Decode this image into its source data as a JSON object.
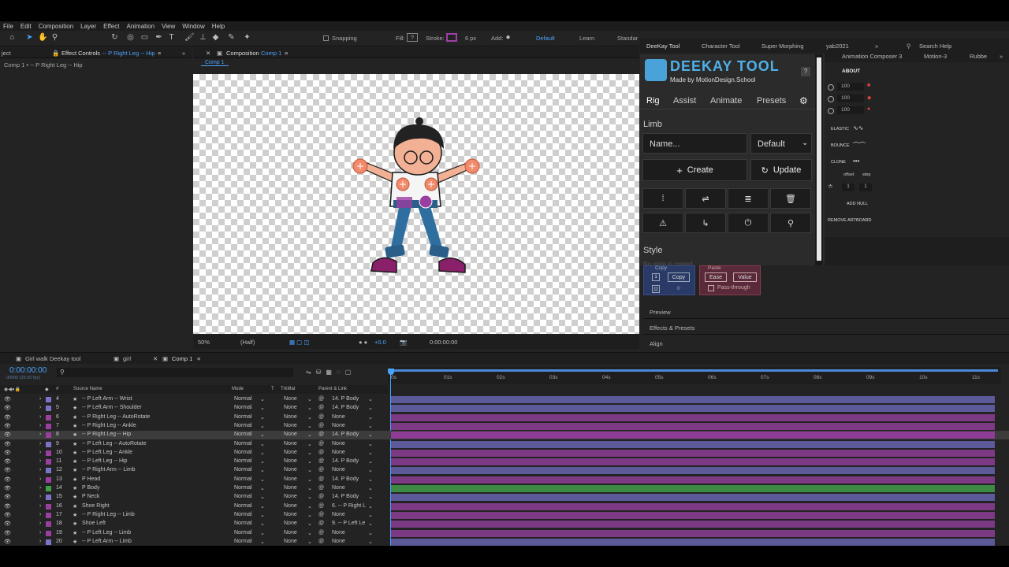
{
  "menu": [
    "File",
    "Edit",
    "Composition",
    "Layer",
    "Effect",
    "Animation",
    "View",
    "Window",
    "Help"
  ],
  "toolbar": {
    "snapping": "Snapping",
    "fill": "Fill:",
    "fill_value": "?",
    "stroke": "Stroke:",
    "stroke_px": "6 px",
    "add": "Add:",
    "workspaces": [
      "Default",
      "Learn",
      "Standar"
    ]
  },
  "left_panel": {
    "tab_project": "ject",
    "tab_effect_controls": "Effect Controls",
    "tab_effect_target": "-- P Right Leg -- Hip",
    "breadcrumb": "Comp 1 • -- P Right Leg -- Hip"
  },
  "comp_panel": {
    "tab_label": "Composition",
    "tab_comp": "Comp 1",
    "subtab": "Comp 1",
    "zoom": "50%",
    "resolution": "(Half)",
    "exposure": "+0.0",
    "timecode": "0:00:00:00"
  },
  "deekay": {
    "tabs": [
      "DeeKay Tool",
      "Character Tool",
      "Super Morphing",
      "yab2021"
    ],
    "logo_title": "DEEKAY TOOL",
    "logo_sub": "Made by MotionDesign.School",
    "help": "?",
    "nav": [
      "Rig",
      "Assist",
      "Animate",
      "Presets"
    ],
    "section_limb": "Limb",
    "name_placeholder": "Name...",
    "default_select": "Default",
    "create": "Create",
    "update": "Update",
    "section_style": "Style",
    "style_hint": "No style is copied",
    "copy_label": "Copy",
    "copy_btn": "Copy",
    "copy_num": "1",
    "copy_zero": "0",
    "paste_label": "Paste",
    "ease_btn": "Ease",
    "value_btn": "Value",
    "pass_through": "Pass-through"
  },
  "right_panel": {
    "tabs": [
      "Animation Composer 3",
      "Motion-3",
      "Rubbe"
    ],
    "search_help": "Search Help",
    "about": "ABOUT",
    "vals": [
      "100",
      "100",
      "100"
    ],
    "elastic": "ELASTIC",
    "bounce": "BOUNCE",
    "clone": "CLONE",
    "offset": "offset",
    "step": "step",
    "offset_val": "1",
    "step_val": "1",
    "add_null": "ADD NULL",
    "remove_artboard": "REMOVE ARTBOARD"
  },
  "side_panels": [
    "Preview",
    "Effects & Presets",
    "Align"
  ],
  "timeline": {
    "tabs": [
      "Girl walk Deekay tool",
      "girl",
      "Comp 1"
    ],
    "timecode": "0:00:00:00",
    "timecode_sub": "00000 (25.00 fps)",
    "search_placeholder": "",
    "headers": {
      "num": "#",
      "source": "Source Name",
      "mode": "Mode",
      "t": "T",
      "trkmat": "TrkMat",
      "parent": "Parent & Link"
    },
    "ruler": [
      "0s",
      "01s",
      "02s",
      "03s",
      "04s",
      "05s",
      "06s",
      "07s",
      "08s",
      "09s",
      "10s",
      "11s"
    ],
    "layers": [
      {
        "num": "4",
        "name": "-- P Left Arm -- Wrist",
        "mode": "Normal",
        "trk": "None",
        "parent": "14. P Body",
        "color": "#7a74c8",
        "bar": "#5d5a9a"
      },
      {
        "num": "5",
        "name": "-- P Left Arm -- Shoulder",
        "mode": "Normal",
        "trk": "None",
        "parent": "14. P Body",
        "color": "#7a74c8",
        "bar": "#5d5a9a"
      },
      {
        "num": "6",
        "name": "-- P Right Leg -- AutoRotate",
        "mode": "Normal",
        "trk": "None",
        "parent": "None",
        "color": "#9a3fa0",
        "bar": "#7c3a85"
      },
      {
        "num": "7",
        "name": "-- P Right Leg -- Ankle",
        "mode": "Normal",
        "trk": "None",
        "parent": "None",
        "color": "#9a3fa0",
        "bar": "#7c3a85"
      },
      {
        "num": "8",
        "name": "-- P Right Leg -- Hip",
        "mode": "Normal",
        "trk": "None",
        "parent": "14. P Body",
        "color": "#9a3fa0",
        "bar": "#8e3c96"
      },
      {
        "num": "9",
        "name": "-- P Left Leg -- AutoRotate",
        "mode": "Normal",
        "trk": "None",
        "parent": "None",
        "color": "#7a74c8",
        "bar": "#5d5a9a"
      },
      {
        "num": "10",
        "name": "-- P Left Leg -- Ankle",
        "mode": "Normal",
        "trk": "None",
        "parent": "None",
        "color": "#9a3fa0",
        "bar": "#7c3a85"
      },
      {
        "num": "11",
        "name": "-- P Left Leg -- Hip",
        "mode": "Normal",
        "trk": "None",
        "parent": "14. P Body",
        "color": "#9a3fa0",
        "bar": "#7c3a85"
      },
      {
        "num": "12",
        "name": "-- P Right Arm -- Limb",
        "mode": "Normal",
        "trk": "None",
        "parent": "None",
        "color": "#7a74c8",
        "bar": "#5d5a9a"
      },
      {
        "num": "13",
        "name": "P Head",
        "mode": "Normal",
        "trk": "None",
        "parent": "14. P Body",
        "color": "#9a3fa0",
        "bar": "#7c3a85"
      },
      {
        "num": "14",
        "name": "P Body",
        "mode": "Normal",
        "trk": "None",
        "parent": "None",
        "color": "#3fa04a",
        "bar": "#3d8a45"
      },
      {
        "num": "15",
        "name": "P Neck",
        "mode": "Normal",
        "trk": "None",
        "parent": "14. P Body",
        "color": "#7a74c8",
        "bar": "#5d5a9a"
      },
      {
        "num": "16",
        "name": "Shoe Right",
        "mode": "Normal",
        "trk": "None",
        "parent": "6. -- P Right L",
        "color": "#9a3fa0",
        "bar": "#7c3a85"
      },
      {
        "num": "17",
        "name": "-- P Right Leg -- Limb",
        "mode": "Normal",
        "trk": "None",
        "parent": "None",
        "color": "#9a3fa0",
        "bar": "#7c3a85"
      },
      {
        "num": "18",
        "name": "Shoe Left",
        "mode": "Normal",
        "trk": "None",
        "parent": "9. -- P Left Le",
        "color": "#9a3fa0",
        "bar": "#7c3a85"
      },
      {
        "num": "19",
        "name": "-- P Left Leg -- Limb",
        "mode": "Normal",
        "trk": "None",
        "parent": "None",
        "color": "#9a3fa0",
        "bar": "#7c3a85"
      },
      {
        "num": "20",
        "name": "-- P Left Arm -- Limb",
        "mode": "Normal",
        "trk": "None",
        "parent": "None",
        "color": "#7a74c8",
        "bar": "#5d5a9a"
      }
    ]
  }
}
